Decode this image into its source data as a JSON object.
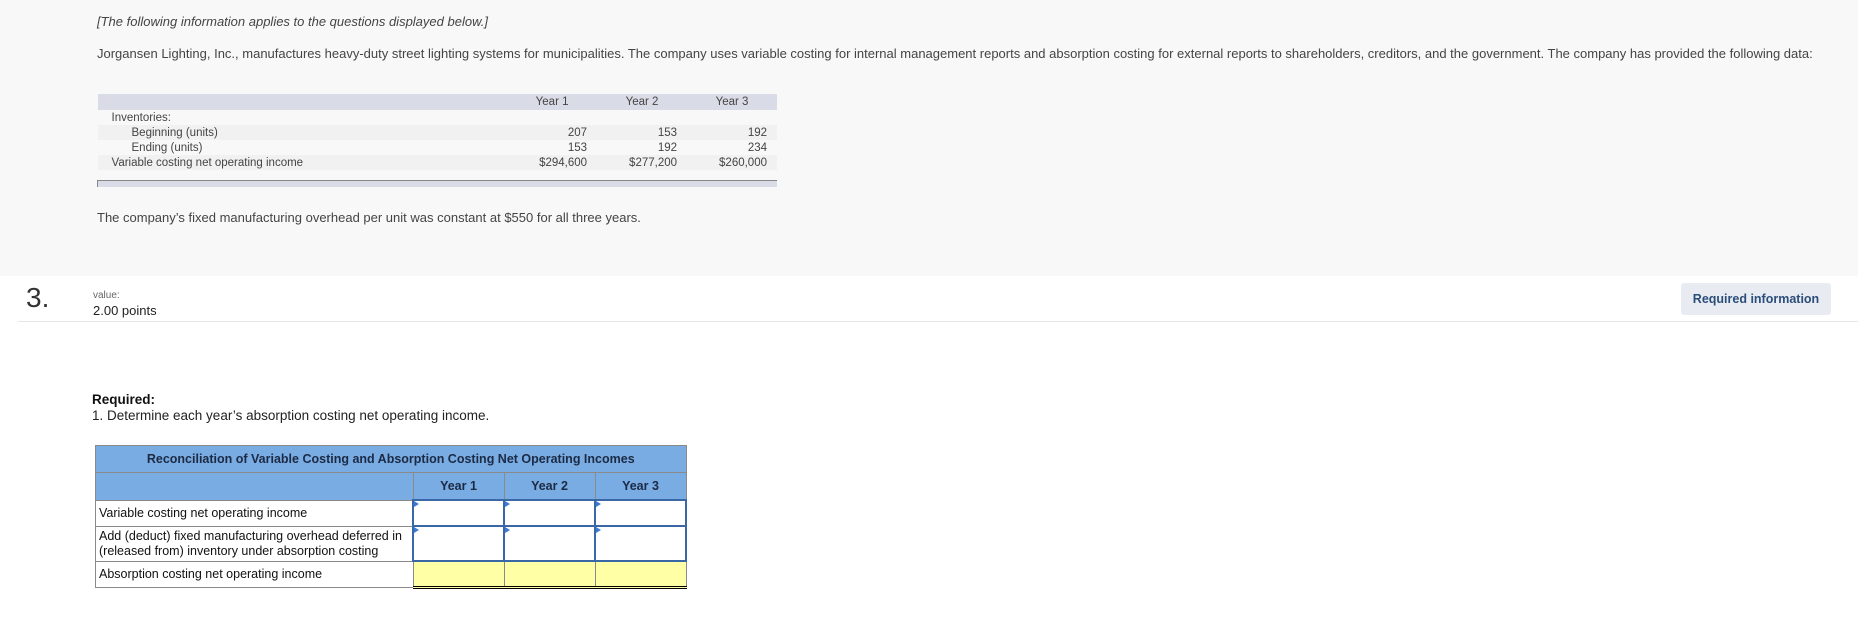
{
  "intro": {
    "note": "[The following information applies to the questions displayed below.]",
    "description": "Jorgansen Lighting, Inc., manufactures heavy-duty street lighting systems for municipalities. The company uses variable costing for internal management reports and absorption costing for external reports to shareholders, creditors, and the government. The company has provided the following data:",
    "table": {
      "headers": [
        "",
        "Year 1",
        "Year 2",
        "Year 3"
      ],
      "rows": [
        {
          "label": "Inventories:",
          "values": [
            "",
            "",
            ""
          ]
        },
        {
          "label": "Beginning (units)",
          "values": [
            "207",
            "153",
            "192"
          ]
        },
        {
          "label": "Ending (units)",
          "values": [
            "153",
            "192",
            "234"
          ]
        },
        {
          "label": "Variable costing net operating income",
          "values": [
            "$294,600",
            "$277,200",
            "$260,000"
          ]
        }
      ]
    },
    "overhead_text": "The company’s fixed manufacturing overhead per unit was constant at $550 for all three years."
  },
  "question": {
    "number": "3.",
    "value_label": "value:",
    "value": "2.00 points",
    "required_info_button": "Required information"
  },
  "required": {
    "heading": "Required:",
    "item": "1. Determine each year’s absorption costing net operating income."
  },
  "reconciliation": {
    "title": "Reconciliation of Variable Costing and Absorption Costing Net Operating Incomes",
    "columns": [
      "Year 1",
      "Year 2",
      "Year 3"
    ],
    "rows": [
      {
        "label": "Variable costing net operating income",
        "values": [
          "",
          "",
          ""
        ]
      },
      {
        "label": "Add (deduct) fixed manufacturing overhead deferred in (released from) inventory under absorption costing",
        "values": [
          "",
          "",
          ""
        ]
      },
      {
        "label": "Absorption costing net operating income",
        "values": [
          "",
          "",
          ""
        ]
      }
    ]
  }
}
